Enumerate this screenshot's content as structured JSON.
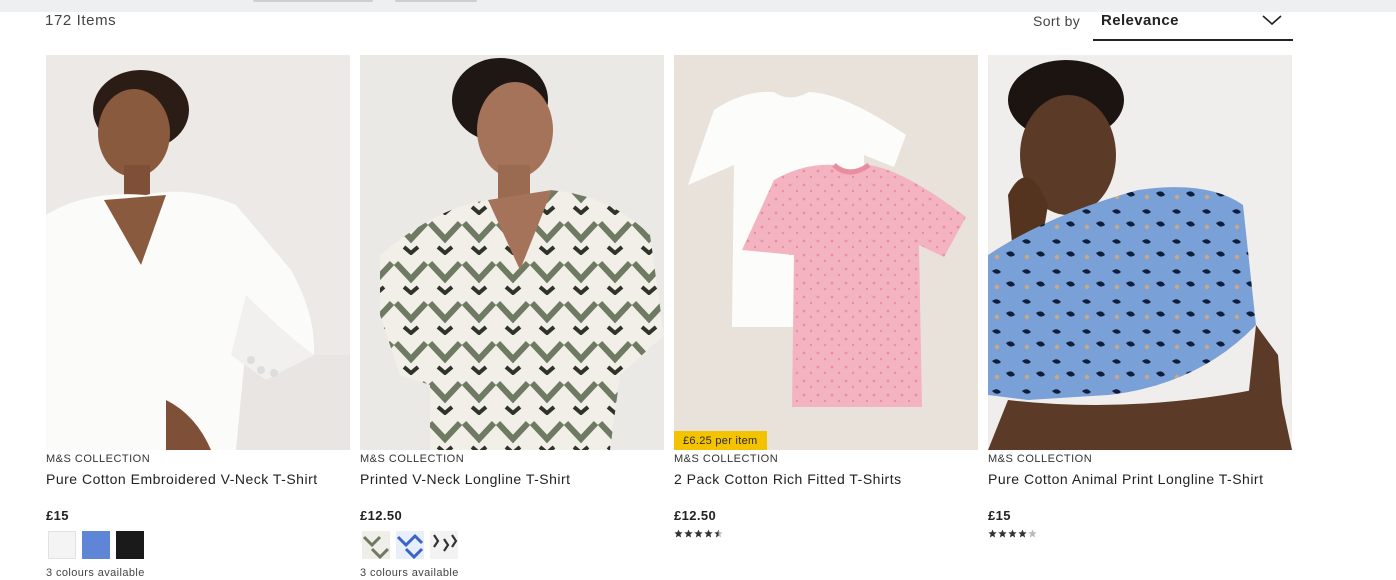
{
  "listing": {
    "item_count": "172 Items"
  },
  "sort": {
    "label": "Sort by",
    "selected": "Relevance"
  },
  "products": [
    {
      "brand": "M&S COLLECTION",
      "title": "Pure Cotton Embroidered V-Neck T-Shirt",
      "price": "£15",
      "swatches": [
        "#f4f4f4",
        "#5f86d6",
        "#1a1a1a"
      ],
      "colours_available": "3 colours available"
    },
    {
      "brand": "M&S COLLECTION",
      "title": "Printed V-Neck Longline T-Shirt",
      "price": "£12.50",
      "swatches": [
        "khaki-pattern",
        "blue-pattern",
        "black-pattern"
      ],
      "colours_available": "3 colours available"
    },
    {
      "brand": "M&S COLLECTION",
      "title": "2 Pack Cotton Rich Fitted T-Shirts",
      "price": "£12.50",
      "badge": "£6.25 per item",
      "rating": 4.5
    },
    {
      "brand": "M&S COLLECTION",
      "title": "Pure Cotton Animal Print Longline T-Shirt",
      "price": "£15",
      "rating": 4
    }
  ],
  "colors": {
    "badge": "#f3c300",
    "text": "#222222",
    "star_filled": "#333333",
    "star_empty": "#bbbbbb"
  },
  "icons": {
    "sort_chevron": "chevron-down-icon",
    "star": "star-icon"
  }
}
